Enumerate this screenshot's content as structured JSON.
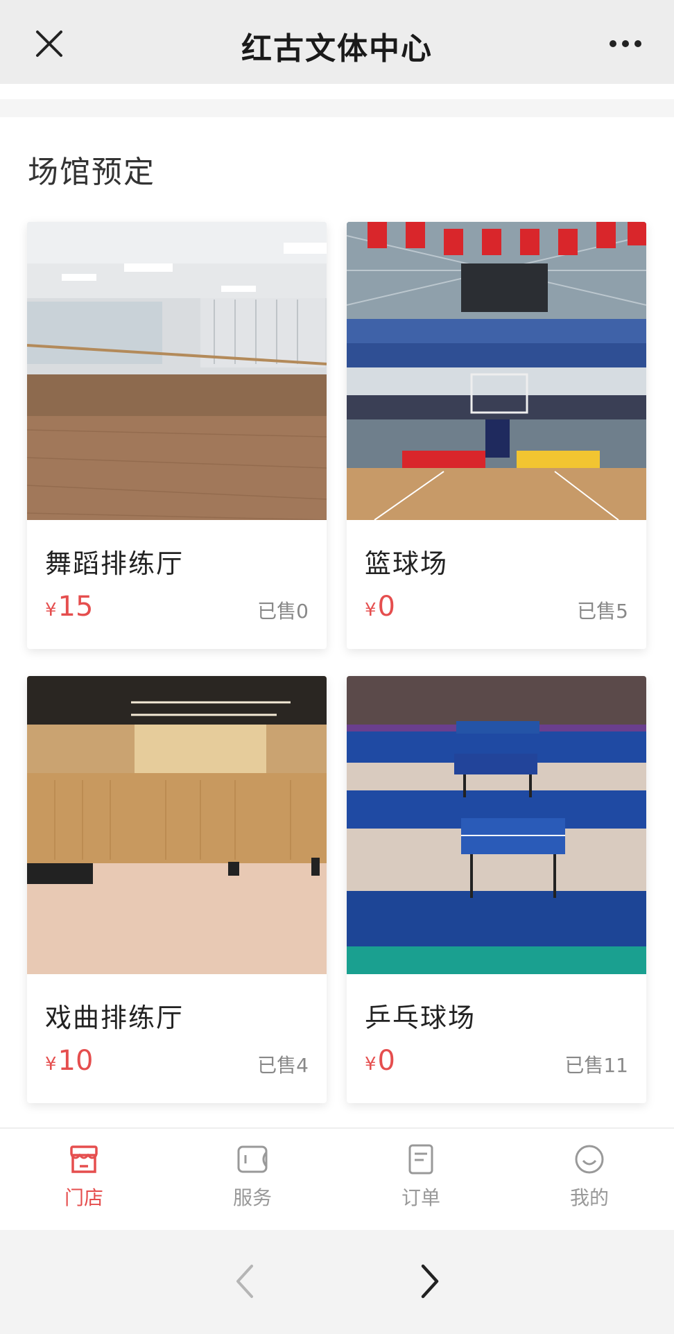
{
  "header": {
    "title": "红古文体中心",
    "close_icon": "close-icon",
    "more_icon": "more-icon"
  },
  "section": {
    "title": "场馆预定"
  },
  "venues": [
    {
      "name": "舞蹈排练厅",
      "currency": "¥",
      "price": "15",
      "sold": "已售0",
      "image": "dance-hall-photo"
    },
    {
      "name": "篮球场",
      "currency": "¥",
      "price": "0",
      "sold": "已售5",
      "image": "basketball-court-photo"
    },
    {
      "name": "戏曲排练厅",
      "currency": "¥",
      "price": "10",
      "sold": "已售4",
      "image": "opera-hall-photo"
    },
    {
      "name": "乒乓球场",
      "currency": "¥",
      "price": "0",
      "sold": "已售11",
      "image": "table-tennis-court-photo"
    }
  ],
  "tabbar": {
    "items": [
      {
        "label": "门店",
        "icon": "store-icon",
        "active": true
      },
      {
        "label": "服务",
        "icon": "wallet-icon",
        "active": false
      },
      {
        "label": "订单",
        "icon": "order-icon",
        "active": false
      },
      {
        "label": "我的",
        "icon": "smiley-icon",
        "active": false
      }
    ]
  },
  "colors": {
    "accent": "#e54e4e",
    "muted": "#999999"
  },
  "browser_nav": {
    "back_icon": "back-arrow-icon",
    "forward_icon": "forward-arrow-icon"
  }
}
